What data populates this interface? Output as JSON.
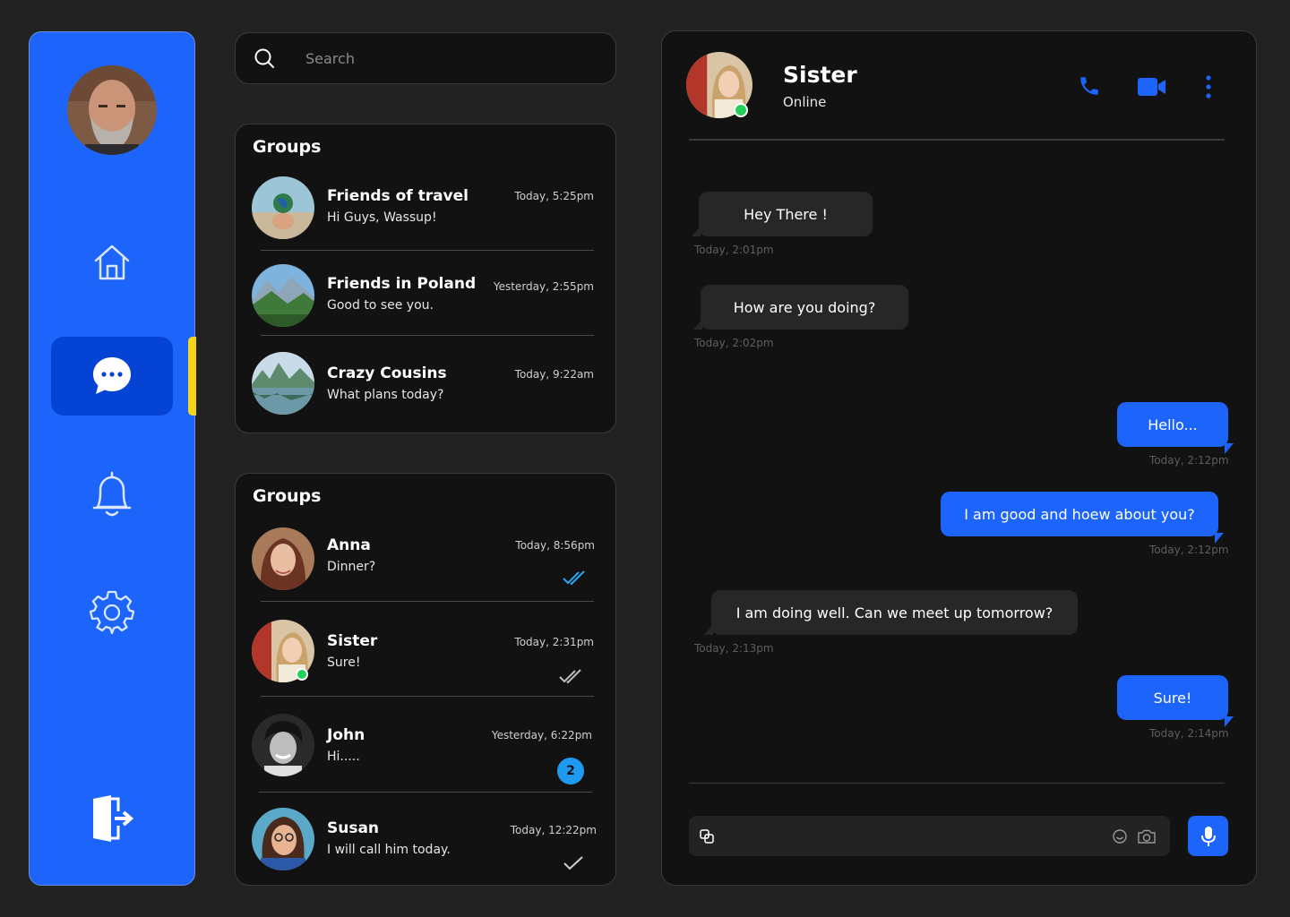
{
  "colors": {
    "accent": "#1c64fa",
    "active_nav": "#0543d4",
    "active_marker": "#f7d51b",
    "online": "#22d05a",
    "panel": "#121212",
    "background": "#222222"
  },
  "sidebar": {
    "items": [
      {
        "id": "home",
        "icon": "home-icon"
      },
      {
        "id": "messages",
        "icon": "chat-bubble-icon",
        "active": true
      },
      {
        "id": "notifications",
        "icon": "bell-icon"
      },
      {
        "id": "settings",
        "icon": "gear-icon"
      },
      {
        "id": "logout",
        "icon": "logout-door-icon"
      }
    ]
  },
  "search": {
    "placeholder": "Search",
    "icon": "search-icon"
  },
  "groups_panel": {
    "title": "Groups",
    "items": [
      {
        "name": "Friends  of travel",
        "message": "Hi Guys, Wassup!",
        "time": "Today, 5:25pm"
      },
      {
        "name": "Friends in Poland",
        "message": "Good to see you.",
        "time": "Yesterday, 2:55pm"
      },
      {
        "name": "Crazy Cousins",
        "message": "What plans today?",
        "time": "Today, 9:22am"
      }
    ]
  },
  "chats_panel": {
    "title": "Groups",
    "items": [
      {
        "name": "Anna",
        "message": "Dinner?",
        "time": "Today, 8:56pm",
        "status": "read-double-check-icon"
      },
      {
        "name": "Sister",
        "message": "Sure!",
        "time": "Today, 2:31pm",
        "status": "delivered-double-check-icon",
        "online": true
      },
      {
        "name": "John",
        "message": "Hi.....",
        "time": "Yesterday, 6:22pm",
        "unread": "2"
      },
      {
        "name": "Susan",
        "message": "I will call him today.",
        "time": "Today, 12:22pm",
        "status": "sent-check-icon"
      }
    ]
  },
  "chat": {
    "contact_name": "Sister",
    "contact_status": "Online",
    "actions": [
      "phone-icon",
      "video-camera-icon",
      "more-vertical-icon"
    ],
    "messages": [
      {
        "direction": "in",
        "text": "Hey There !",
        "time": "Today, 2:01pm"
      },
      {
        "direction": "in",
        "text": "How are you doing?",
        "time": "Today, 2:02pm"
      },
      {
        "direction": "out",
        "text": "Hello...",
        "time": "Today, 2:12pm"
      },
      {
        "direction": "out",
        "text": "I am good  and hoew about you?",
        "time": "Today, 2:12pm"
      },
      {
        "direction": "in",
        "text": "I am doing well. Can we meet up tomorrow?",
        "time": "Today, 2:13pm"
      },
      {
        "direction": "out",
        "text": "Sure!",
        "time": "Today, 2:14pm"
      }
    ],
    "composer": {
      "value": "",
      "icons": [
        "attachment-icon",
        "emoji-icon",
        "camera-icon",
        "microphone-icon"
      ]
    }
  }
}
